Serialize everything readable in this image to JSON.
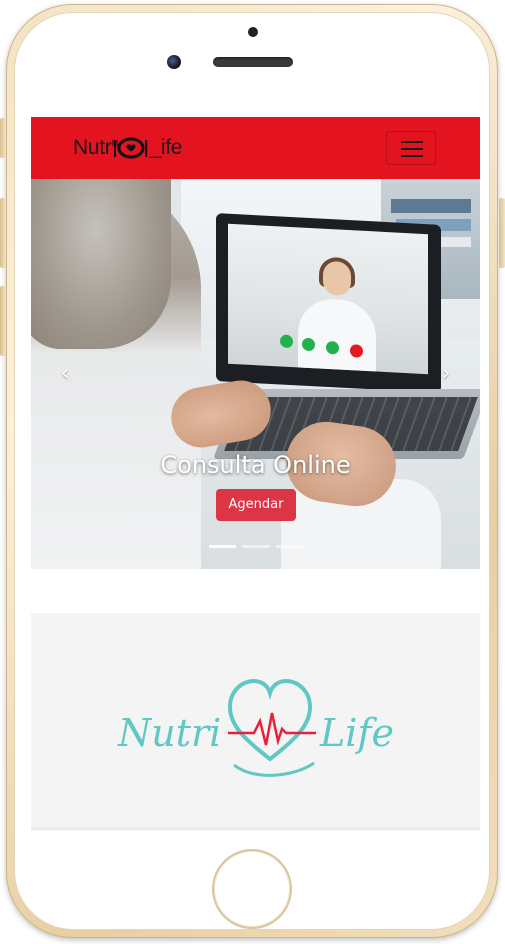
{
  "device": {
    "frame_color": "#f3e3c3"
  },
  "navbar": {
    "bg_color": "#e3131f",
    "brand_left": "Nutr",
    "brand_right": "_ife",
    "toggler_icon": "hamburger-icon"
  },
  "carousel": {
    "prev_icon": "chevron-left-icon",
    "next_icon": "chevron-right-icon",
    "prev_glyph": "‹",
    "next_glyph": "›",
    "slide": {
      "title": "Consulta Online",
      "button_label": "Agendar",
      "button_color": "#dc3545"
    },
    "indicator_count": 3,
    "active_indicator": 1
  },
  "footer_logo": {
    "left": "Nutri",
    "right": "Life",
    "color": "#5fc8c4",
    "heart_color": "#e8213a"
  }
}
